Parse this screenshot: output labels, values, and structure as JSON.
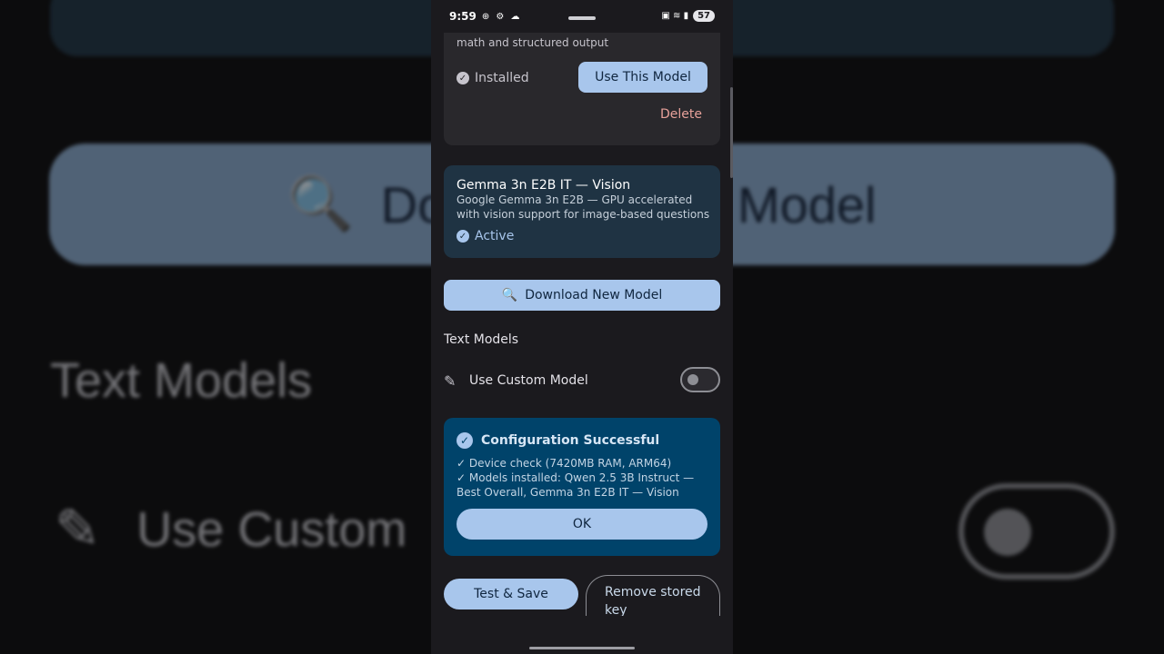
{
  "status_bar": {
    "time": "9:59",
    "left_icons": "⊕ ⚙ ☁",
    "right_icons": "▣ ≋ ▮",
    "battery": "57"
  },
  "installed_card": {
    "description": "math and structured output",
    "status": "Installed",
    "use_button": "Use This Model",
    "delete_button": "Delete"
  },
  "active_card": {
    "title": "Gemma 3n E2B IT — Vision",
    "description": "Google Gemma 3n E2B — GPU accelerated with vision support for image-based questions",
    "status": "Active"
  },
  "download_button": "Download New Model",
  "text_models": {
    "section_title": "Text Models",
    "custom_model_label": "Use Custom Model",
    "custom_model_enabled": false
  },
  "success_card": {
    "title": "Configuration Successful",
    "line1": "✓ Device check (7420MB RAM, ARM64)",
    "line2": "✓ Models installed: Qwen 2.5 3B Instruct — Best Overall, Gemma 3n E2B IT — Vision",
    "ok_button": "OK"
  },
  "actions": {
    "test_save": "Test & Save",
    "remove_key": "Remove stored key"
  },
  "background": {
    "search_text": "Download New Model",
    "section_title": "Text Models",
    "custom_label": "Use Custom"
  },
  "colors": {
    "accent": "#a8c6ec",
    "success_bg": "#00436a",
    "active_bg": "#1f3343",
    "delete": "#e7a19a"
  }
}
